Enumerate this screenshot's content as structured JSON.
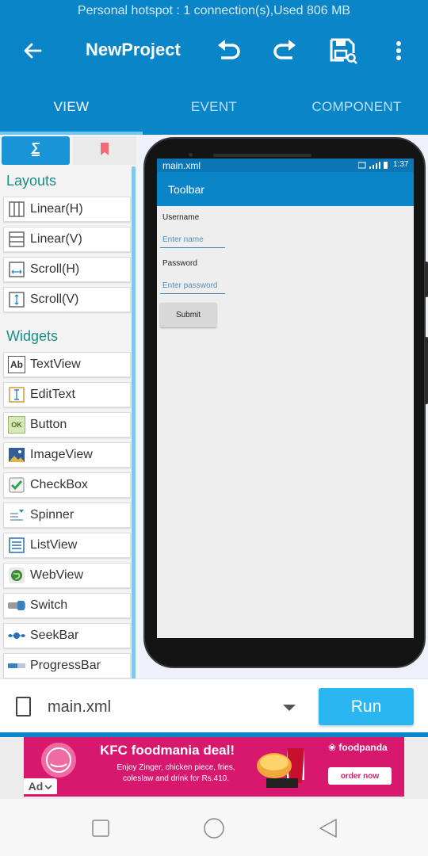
{
  "status_bar": {
    "text": "Personal hotspot : 1 connection(s),Used  806 MB"
  },
  "app_bar": {
    "title": "NewProject"
  },
  "tabs": [
    {
      "label": "VIEW",
      "active": true
    },
    {
      "label": "EVENT",
      "active": false
    },
    {
      "label": "COMPONENT",
      "active": false
    }
  ],
  "palette": {
    "layouts_title": "Layouts",
    "layouts": [
      {
        "label": "Linear(H)",
        "icon": "linear-h-icon"
      },
      {
        "label": "Linear(V)",
        "icon": "linear-v-icon"
      },
      {
        "label": "Scroll(H)",
        "icon": "scroll-h-icon"
      },
      {
        "label": "Scroll(V)",
        "icon": "scroll-v-icon"
      }
    ],
    "widgets_title": "Widgets",
    "widgets": [
      {
        "label": "TextView",
        "icon": "textview-icon"
      },
      {
        "label": "EditText",
        "icon": "edittext-icon"
      },
      {
        "label": "Button",
        "icon": "button-icon"
      },
      {
        "label": "ImageView",
        "icon": "imageview-icon"
      },
      {
        "label": "CheckBox",
        "icon": "checkbox-icon"
      },
      {
        "label": "Spinner",
        "icon": "spinner-icon"
      },
      {
        "label": "ListView",
        "icon": "listview-icon"
      },
      {
        "label": "WebView",
        "icon": "webview-icon"
      },
      {
        "label": "Switch",
        "icon": "switch-icon"
      },
      {
        "label": "SeekBar",
        "icon": "seekbar-icon"
      },
      {
        "label": "ProgressBar",
        "icon": "progressbar-icon"
      }
    ],
    "textview_icon_text": "Ab",
    "button_icon_text": "OK"
  },
  "preview": {
    "file": "main.xml",
    "time": "1:37",
    "toolbar_title": "Toolbar",
    "username_label": "Username",
    "username_placeholder": "Enter name",
    "password_label": "Password",
    "password_placeholder": "Enter password",
    "submit_label": "Submit"
  },
  "bottom_bar": {
    "file_name": "main.xml",
    "run_label": "Run"
  },
  "ad": {
    "title": "KFC foodmania deal!",
    "body": "Enjoy Zinger, chicken piece, fries, coleslaw and drink for Rs.410.",
    "brand": "❀ foodpanda",
    "cta": "order now",
    "badge": "Ad"
  },
  "colors": {
    "primary": "#0a85c8",
    "accent": "#2ab6f0",
    "section_title": "#168f88",
    "ad_background": "#d8186e"
  }
}
